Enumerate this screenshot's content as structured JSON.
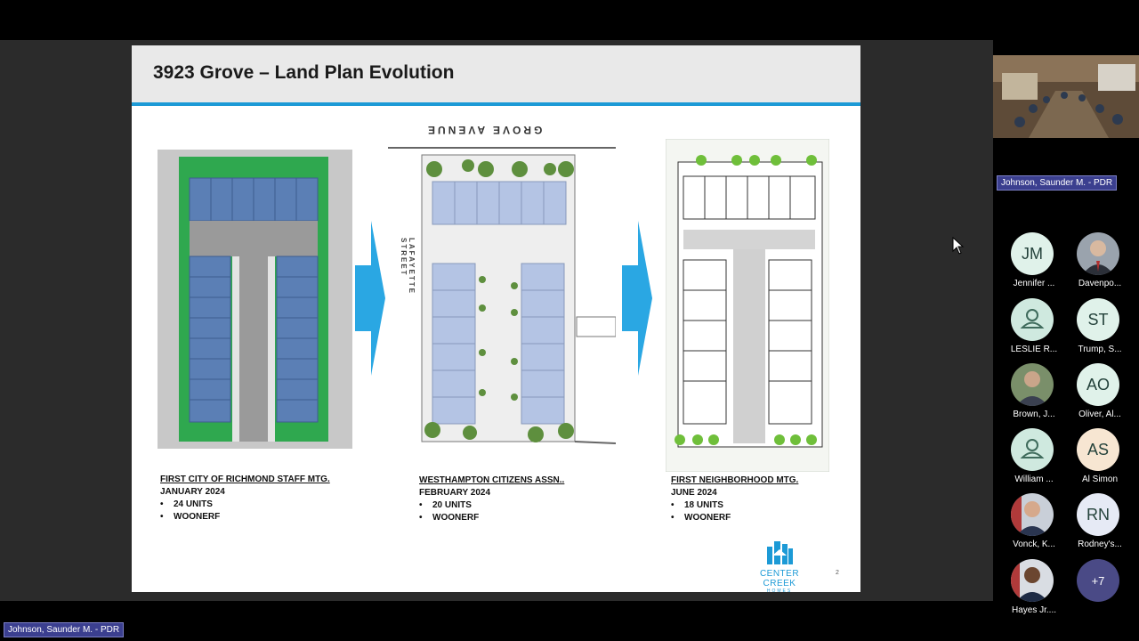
{
  "slide": {
    "title": "3923 Grove – Land Plan Evolution",
    "plans": [
      {
        "heading": "FIRST CITY OF RICHMOND STAFF MTG.",
        "date": "JANUARY 2024",
        "bullets": [
          "24 UNITS",
          "WOONERF"
        ]
      },
      {
        "heading": "WESTHAMPTON CITIZENS ASSN..",
        "date": "FEBRUARY 2024",
        "bullets": [
          "20 UNITS",
          "WOONERF"
        ]
      },
      {
        "heading": "FIRST NEIGHBORHOOD MTG.",
        "date": "JUNE 2024",
        "bullets": [
          "18 UNITS",
          "WOONERF"
        ]
      }
    ],
    "street_top": "GROVE AVENUE",
    "street_side": "LAFAYETTE STREET",
    "logo_name": "CENTER CREEK",
    "logo_sub": "HOMES",
    "page_number": "2"
  },
  "meeting": {
    "active_speaker": "Johnson, Saunder M. - PDR",
    "screen_share_label": "Johnson, Saunder M. - PDR",
    "participants": [
      {
        "name": "Jennifer ...",
        "initials": "JM",
        "avatar": "initials"
      },
      {
        "name": "Davenpo...",
        "initials": "",
        "avatar": "photo"
      },
      {
        "name": "LESLIE R...",
        "initials": "",
        "avatar": "person-icon"
      },
      {
        "name": "Trump, S...",
        "initials": "ST",
        "avatar": "initials"
      },
      {
        "name": "Brown, J...",
        "initials": "",
        "avatar": "photo"
      },
      {
        "name": "Oliver, Al...",
        "initials": "AO",
        "avatar": "initials"
      },
      {
        "name": "William ...",
        "initials": "",
        "avatar": "person-icon"
      },
      {
        "name": "Al Simon",
        "initials": "AS",
        "avatar": "initials"
      },
      {
        "name": "Vonck, K...",
        "initials": "",
        "avatar": "photo"
      },
      {
        "name": "Rodney's...",
        "initials": "RN",
        "avatar": "initials"
      },
      {
        "name": "Hayes Jr....",
        "initials": "",
        "avatar": "photo"
      }
    ],
    "more_count": "+7"
  },
  "colors": {
    "accent": "#1c9ad6",
    "chip": "#3b3f8f",
    "unit_blue": "#5b7fb5",
    "lawn": "#2fa84f"
  }
}
